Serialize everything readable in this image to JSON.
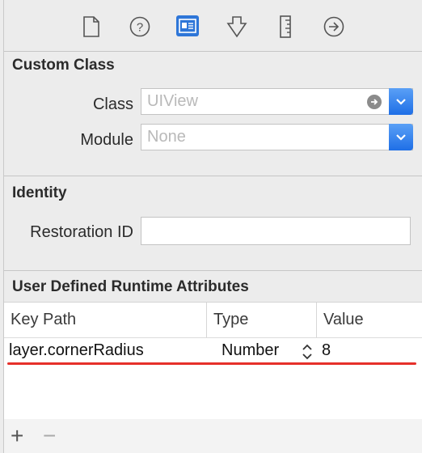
{
  "toolbar": {
    "icons": [
      "file-inspector-icon",
      "quick-help-icon",
      "identity-inspector-icon",
      "attributes-inspector-icon",
      "size-inspector-icon",
      "connections-inspector-icon"
    ]
  },
  "custom_class": {
    "title": "Custom Class",
    "class_label": "Class",
    "class_placeholder": "UIView",
    "module_label": "Module",
    "module_placeholder": "None"
  },
  "identity": {
    "title": "Identity",
    "restoration_label": "Restoration ID",
    "restoration_value": ""
  },
  "runtime_attributes": {
    "title": "User Defined Runtime Attributes",
    "columns": [
      "Key Path",
      "Type",
      "Value"
    ],
    "rows": [
      {
        "key_path": "layer.cornerRadius",
        "type": "Number",
        "value": "8"
      }
    ]
  },
  "bottom": {
    "add_label": "+",
    "remove_label": "−"
  },
  "colors": {
    "accent": "#2e76d8",
    "annotation": "#e6302a"
  }
}
